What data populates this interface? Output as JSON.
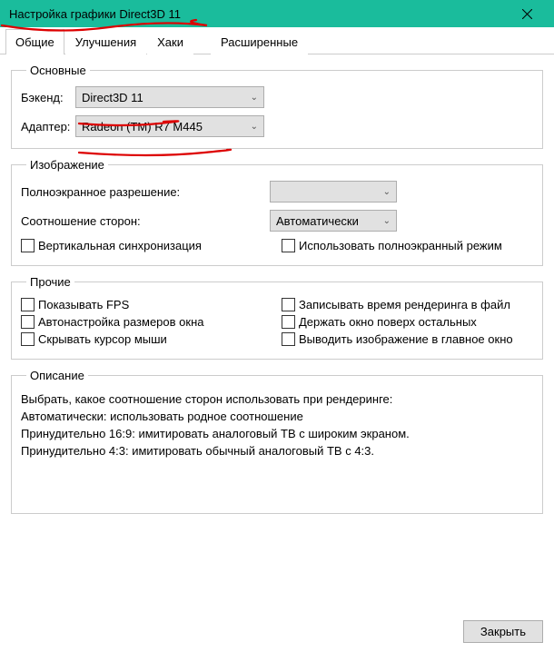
{
  "window": {
    "title": "Настройка графики Direct3D 11",
    "close_button": "×"
  },
  "tabs": {
    "general": "Общие",
    "enhancements": "Улучшения",
    "hacks": "Хаки",
    "advanced": "Расширенные"
  },
  "groups": {
    "basic": {
      "title": "Основные",
      "backend_label": "Бэкенд:",
      "backend_value": "Direct3D 11",
      "adapter_label": "Адаптер:",
      "adapter_value": "Radeon (TM) R7 M445"
    },
    "image": {
      "title": "Изображение",
      "fullres_label": "Полноэкранное разрешение:",
      "fullres_value": "",
      "aspect_label": "Соотношение сторон:",
      "aspect_value": "Автоматически",
      "vsync_label": "Вертикальная синхронизация",
      "fullscreen_label": "Использовать полноэкранный режим"
    },
    "other": {
      "title": "Прочие",
      "show_fps": "Показывать FPS",
      "log_render": "Записывать время рендеринга в файл",
      "auto_window": "Автонастройка размеров окна",
      "keep_ontop": "Держать окно поверх остальных",
      "hide_cursor": "Скрывать курсор мыши",
      "render_to_main": "Выводить изображение в главное окно"
    },
    "description": {
      "title": "Описание",
      "text": "Выбрать, какое соотношение сторон использовать при рендеринге:\nАвтоматически: использовать родное соотношение\nПринудительно 16:9: имитировать аналоговый ТВ с широким экраном.\nПринудительно 4:3: имитировать обычный аналоговый ТВ с 4:3."
    }
  },
  "footer": {
    "close_btn": "Закрыть"
  }
}
